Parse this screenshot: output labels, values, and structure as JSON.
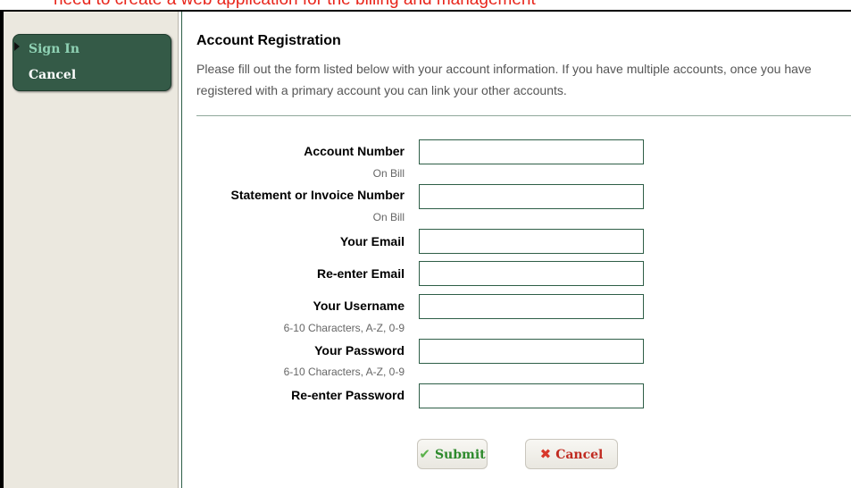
{
  "annotation": {
    "text": "need to create a web application for the billing and management"
  },
  "sidebar": {
    "items": [
      {
        "label": "Sign In"
      },
      {
        "label": "Cancel"
      }
    ]
  },
  "form": {
    "title": "Account Registration",
    "intro": "Please fill out the form listed below with your account information. If you have multiple accounts, once you have registered with a primary account you can link your other accounts.",
    "fields": [
      {
        "label": "Account Number",
        "hint": "On Bill",
        "value": ""
      },
      {
        "label": "Statement or Invoice Number",
        "hint": "On Bill",
        "value": ""
      },
      {
        "label": "Your Email",
        "hint": "",
        "value": ""
      },
      {
        "label": "Re-enter Email",
        "hint": "",
        "value": ""
      },
      {
        "label": "Your Username",
        "hint": "6-10 Characters, A-Z, 0-9",
        "value": ""
      },
      {
        "label": "Your Password",
        "hint": "6-10 Characters, A-Z, 0-9",
        "value": ""
      },
      {
        "label": "Re-enter Password",
        "hint": "",
        "value": ""
      }
    ],
    "buttons": {
      "submit": {
        "label": "Submit",
        "icon": "checkmark-icon",
        "color": "#2d8a2c"
      },
      "cancel": {
        "label": "Cancel",
        "icon": "x-icon",
        "color": "#c02a20"
      }
    }
  },
  "colors": {
    "sidebar_bg": "#ebe8df",
    "menu_bg": "#345a47",
    "accent": "#2e5e47"
  }
}
